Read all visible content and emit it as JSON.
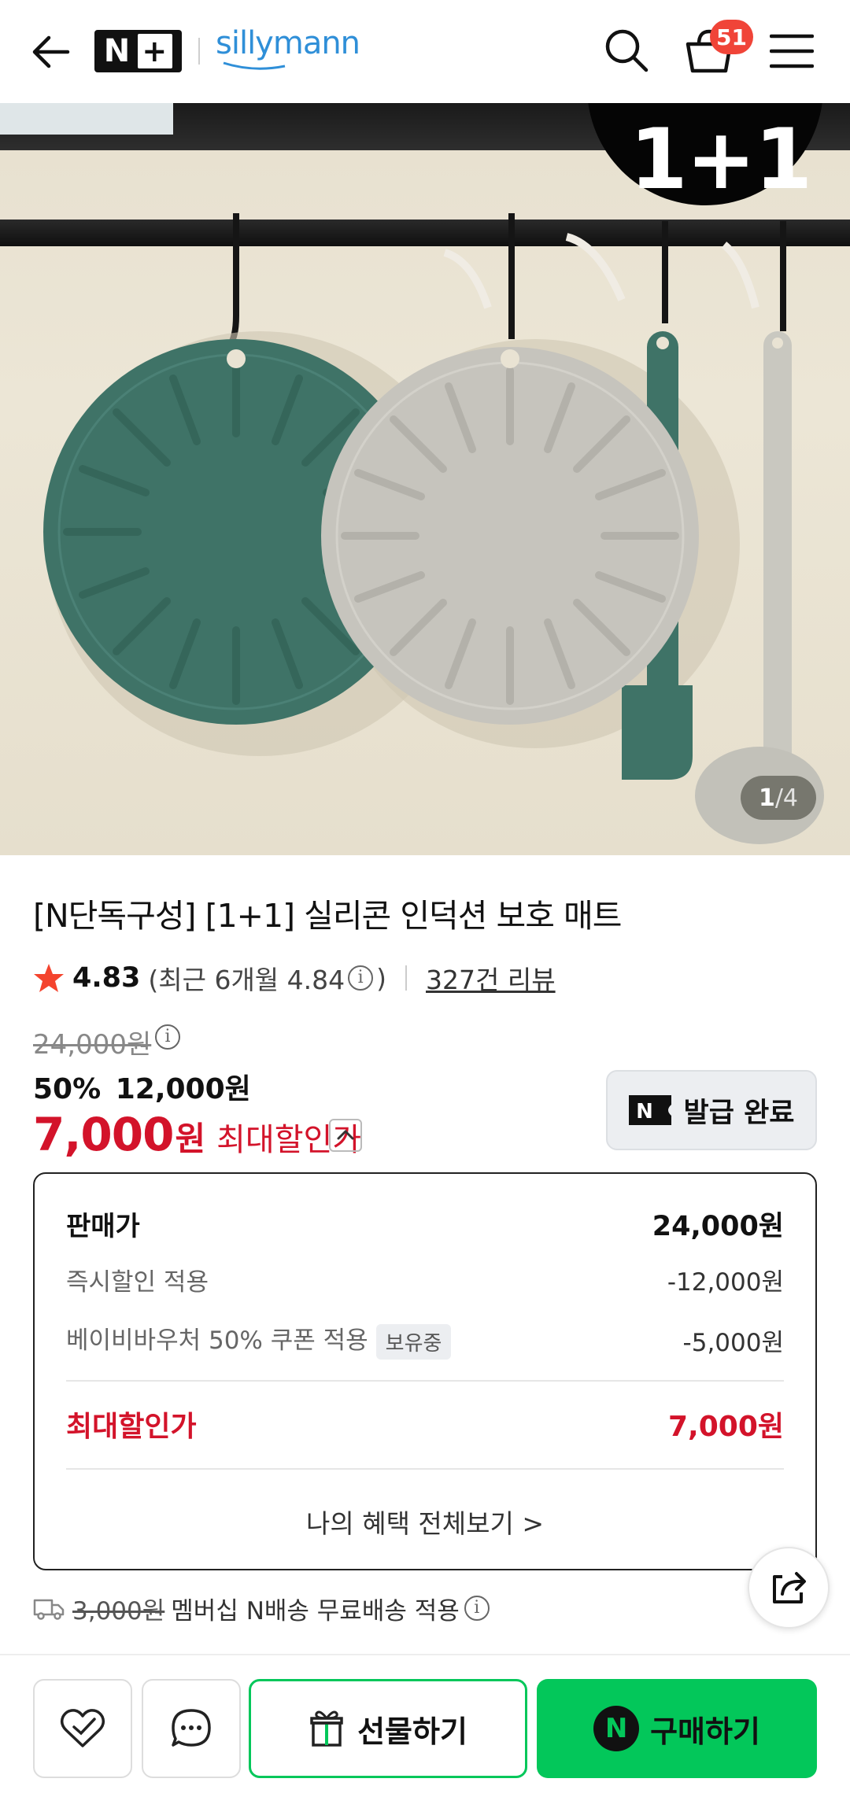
{
  "header": {
    "nplus_logo": "N+",
    "brand_logo": "sillymann",
    "cart_count": "51"
  },
  "hero": {
    "badge": "1+1",
    "counter_current": "1",
    "counter_total": "/4"
  },
  "product": {
    "title": "[N단독구성] [1+1] 실리콘 인덕션 보호 매트",
    "rating": "4.83",
    "recent_rating_prefix": "(최근 6개월 4.84",
    "recent_rating_suffix": ")",
    "review_count": "327건 리뷰",
    "original_price": "24,000원",
    "discount_percent": "50%",
    "discounted_price": "12,000원",
    "max_price": "7,000",
    "max_won": "원",
    "max_label": "최대할인가",
    "coupon_button": "발급 완료"
  },
  "price_box": {
    "rows": [
      {
        "label": "판매가",
        "value": "24,000원"
      },
      {
        "label": "즉시할인 적용",
        "value": "-12,000원"
      },
      {
        "label": "베이비바우처 50% 쿠폰 적용",
        "badge": "보유중",
        "value": "-5,000원"
      }
    ],
    "total_label": "최대할인가",
    "total_value": "7,000원",
    "more_link": "나의 혜택 전체보기 >"
  },
  "shipping": {
    "strike_price": "3,000원",
    "text": "멤버십 N배송 무료배송 적용"
  },
  "bottom_bar": {
    "gift_label": "선물하기",
    "buy_label": "구매하기",
    "buy_icon_letter": "N"
  },
  "colors": {
    "accent_red": "#d3132a",
    "naver_green": "#03c75a",
    "badge_red": "#f04438"
  }
}
